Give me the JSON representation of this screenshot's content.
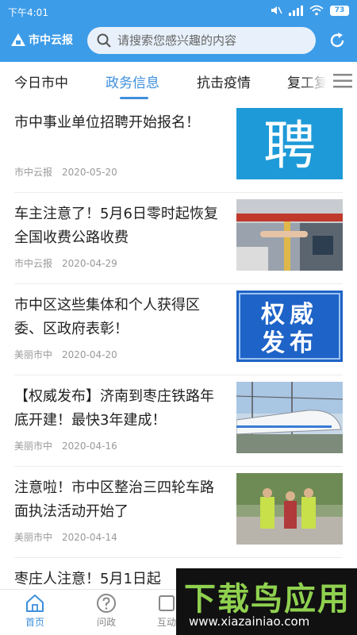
{
  "status_bar": {
    "time": "下午4:01",
    "battery": "73"
  },
  "header": {
    "logo_text": "市中云报",
    "search_placeholder": "请搜索您感兴趣的内容"
  },
  "tabs": [
    {
      "label": "今日市中",
      "active": false
    },
    {
      "label": "政务信息",
      "active": true
    },
    {
      "label": "抗击疫情",
      "active": false
    },
    {
      "label": "复工复",
      "active": false
    }
  ],
  "news": [
    {
      "title": "市中事业单位招聘开始报名！",
      "source": "市中云报",
      "date": "2020-05-20",
      "thumb_text": "聘"
    },
    {
      "title": "车主注意了！5月6日零时起恢复全国收费公路收费",
      "source": "市中云报",
      "date": "2020-04-29"
    },
    {
      "title": "市中区这些集体和个人获得区委、区政府表彰！",
      "source": "美丽市中",
      "date": "2020-04-20",
      "thumb_text_1": "权威",
      "thumb_text_2": "发布"
    },
    {
      "title": "【权威发布】济南到枣庄铁路年底开建！最快3年建成！",
      "source": "美丽市中",
      "date": "2020-04-16"
    },
    {
      "title": "注意啦！市中区整治三四轮车路面执法活动开始了",
      "source": "美丽市中",
      "date": "2020-04-14"
    },
    {
      "title": "枣庄人注意！5月1日起"
    }
  ],
  "bottom_nav": [
    {
      "label": "首页",
      "icon": "home-icon",
      "active": true
    },
    {
      "label": "问政",
      "icon": "question-icon",
      "active": false
    },
    {
      "label": "互动",
      "icon": "interact-icon",
      "active": false
    }
  ],
  "watermark": {
    "big": "下载鸟应用",
    "small": "www.xiazainiao.com"
  },
  "colors": {
    "brand": "#3d9ce8",
    "active_tab": "#3d8fdc"
  }
}
